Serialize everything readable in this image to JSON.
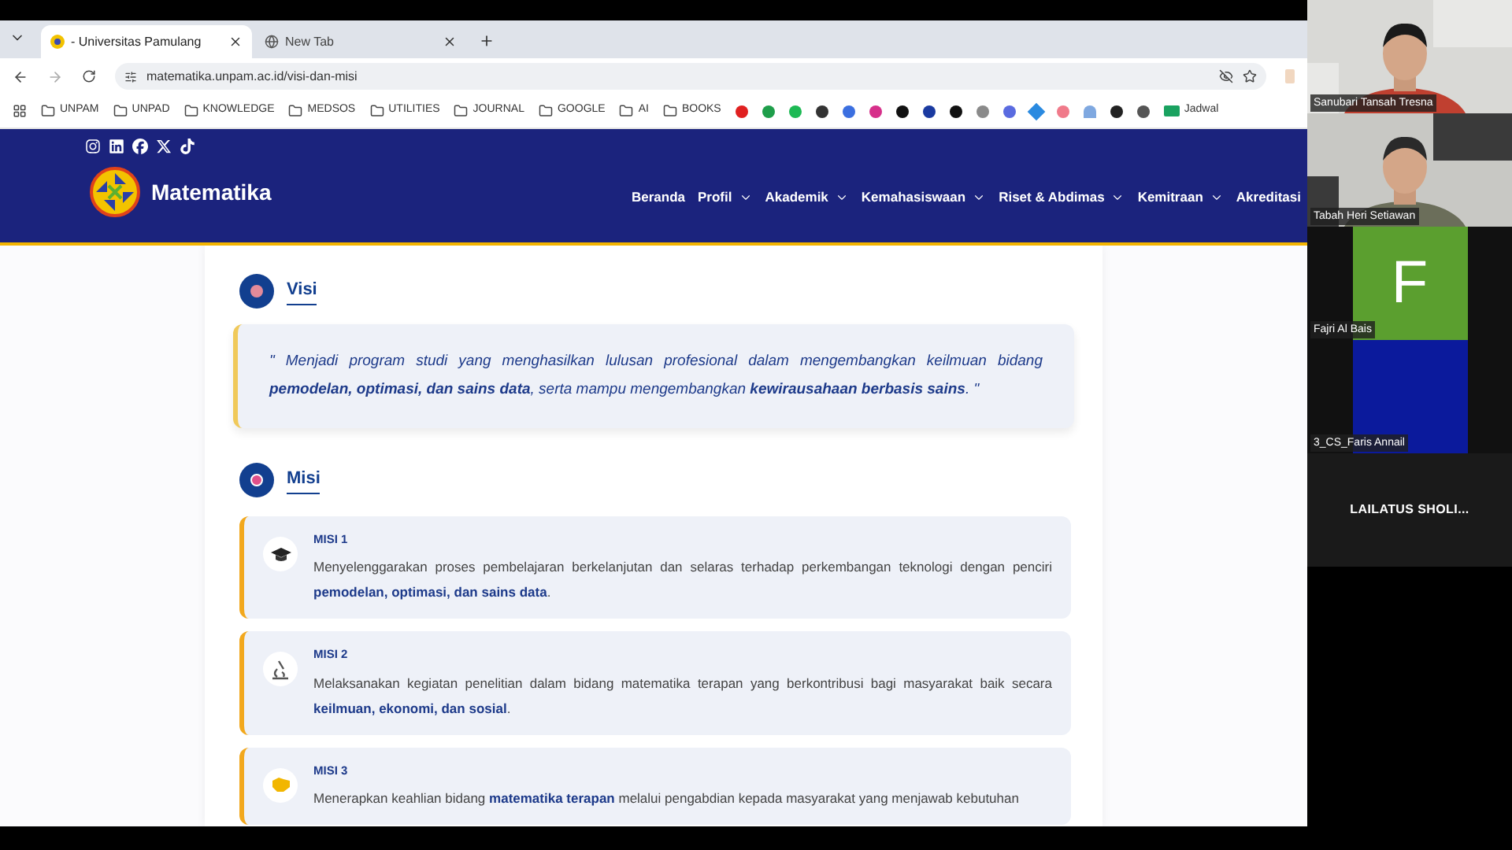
{
  "browser": {
    "tabs": [
      {
        "title": "- Universitas Pamulang",
        "selected": true
      },
      {
        "title": "New Tab",
        "selected": false
      }
    ],
    "url": "matematika.unpam.ac.id/visi-dan-misi",
    "bookmark_folders": [
      "UNPAM",
      "UNPAD",
      "KNOWLEDGE",
      "MEDSOS",
      "UTILITIES",
      "JOURNAL",
      "GOOGLE",
      "AI",
      "BOOKS"
    ],
    "bookmark_link": "Jadwal"
  },
  "site": {
    "brand": "Matematika",
    "nav": [
      {
        "label": "Beranda",
        "dropdown": false
      },
      {
        "label": "Profil",
        "dropdown": true
      },
      {
        "label": "Akademik",
        "dropdown": true
      },
      {
        "label": "Kemahasiswaan",
        "dropdown": true
      },
      {
        "label": "Riset & Abdimas",
        "dropdown": true
      },
      {
        "label": "Kemitraan",
        "dropdown": true
      },
      {
        "label": "Akreditasi",
        "dropdown": false
      }
    ]
  },
  "visi": {
    "title": "Visi",
    "text": "\" Menjadi program studi yang menghasilkan lulusan profesional dalam mengembangkan keilmuan bidang **pemodelan, optimasi, dan sains data**, serta mampu mengembangkan **kewirausahaan berbasis sains**. \""
  },
  "misi": {
    "title": "Misi",
    "items": [
      {
        "title": "MISI 1",
        "kind": "graduation",
        "text": "Menyelenggarakan proses pembelajaran berkelanjutan dan selaras terhadap perkembangan teknologi dengan penciri **pemodelan, optimasi, dan sains data**."
      },
      {
        "title": "MISI 2",
        "kind": "research",
        "text": "Melaksanakan kegiatan penelitian dalam bidang matematika terapan yang berkontribusi bagi masyarakat baik secara **keilmuan, ekonomi, dan sosial**."
      },
      {
        "title": "MISI 3",
        "kind": "service",
        "text": "Menerapkan keahlian bidang **matematika terapan** melalui pengabdian kepada masyarakat yang menjawab kebutuhan"
      }
    ]
  },
  "meeting": {
    "participants": [
      {
        "name": "Sanubari Tansah Tresna",
        "kind": "video"
      },
      {
        "name": "Tabah Heri Setiawan",
        "kind": "video"
      },
      {
        "name": "Fajri Al Bais",
        "kind": "avatar",
        "initial": "F",
        "color": "#5b9f2f"
      },
      {
        "name": "3_CS_Faris Annail",
        "kind": "avatar",
        "color": "#0b1a9c"
      },
      {
        "name": "LAILATUS SHOLI...",
        "kind": "name_only"
      }
    ]
  }
}
